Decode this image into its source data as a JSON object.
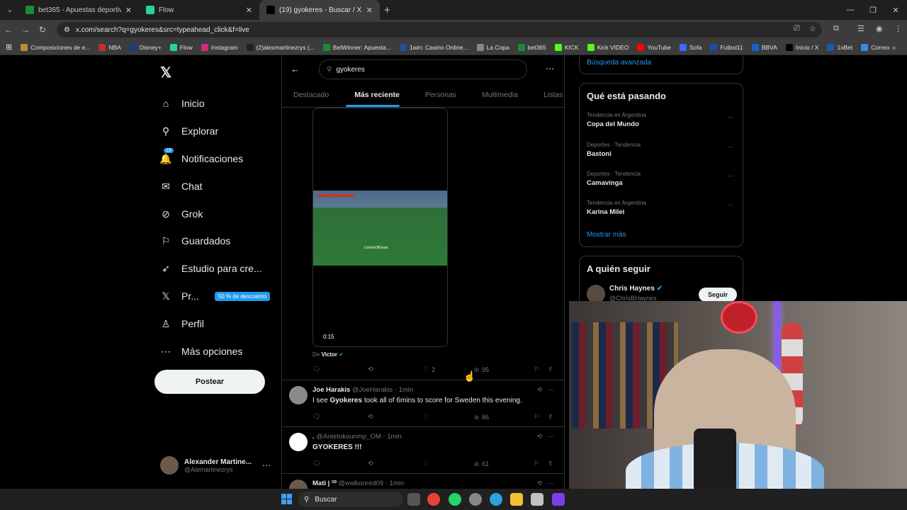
{
  "browser": {
    "tabs": [
      {
        "title": "bet365 - Apuestas deportivas e",
        "color": "#1b8a3c",
        "active": false
      },
      {
        "title": "Flow",
        "color": "#2ad29a",
        "active": false
      },
      {
        "title": "(19) gyokeres - Buscar / X",
        "color": "#000000",
        "active": true
      }
    ],
    "url": "x.com/search?q=gyokeres&src=typeahead_click&f=live",
    "bookmarks": [
      {
        "label": "Composiciones de e...",
        "color": "#c08a3a"
      },
      {
        "label": "NBA",
        "color": "#c0302a"
      },
      {
        "label": "Disney+",
        "color": "#1a3a8a"
      },
      {
        "label": "Flow",
        "color": "#2ad29a"
      },
      {
        "label": "Instagram",
        "color": "#d02a7a"
      },
      {
        "label": "(2)alexmartinezrys (...",
        "color": "#222222"
      },
      {
        "label": "BetWinner: Apuesta...",
        "color": "#1a8a3a"
      },
      {
        "label": "1win: Casino Online...",
        "color": "#2a4a9a"
      },
      {
        "label": "La Copa",
        "color": "#888888"
      },
      {
        "label": "bet365",
        "color": "#1b8a3c"
      },
      {
        "label": "KICK",
        "color": "#53fc18"
      },
      {
        "label": "Kick VIDEO",
        "color": "#53fc18"
      },
      {
        "label": "YouTube",
        "color": "#ff0000"
      },
      {
        "label": "Sofa",
        "color": "#3a6aff"
      },
      {
        "label": "Futbol11",
        "color": "#1a4aaa"
      },
      {
        "label": "BBVA",
        "color": "#1464c8"
      },
      {
        "label": "Inicio / X",
        "color": "#000000"
      },
      {
        "label": "1xBet",
        "color": "#1a5aaa"
      },
      {
        "label": "Correo",
        "color": "#3a8ae8"
      }
    ]
  },
  "sidebar": {
    "items": [
      {
        "label": "Inicio",
        "icon": "⌂"
      },
      {
        "label": "Explorar",
        "icon": "⚲"
      },
      {
        "label": "Notificaciones",
        "icon": "🔔",
        "badge": "19"
      },
      {
        "label": "Chat",
        "icon": "✉"
      },
      {
        "label": "Grok",
        "icon": "⊘"
      },
      {
        "label": "Guardados",
        "icon": "⚐"
      },
      {
        "label": "Estudio para cre...",
        "icon": "➶"
      },
      {
        "label": "Pr...",
        "icon": "𝕏",
        "promo": "50 % de descuento"
      },
      {
        "label": "Perfil",
        "icon": "♙"
      },
      {
        "label": "Más opciones",
        "icon": "⋯"
      }
    ],
    "post_label": "Postear",
    "account": {
      "name": "Alexander Martine...",
      "handle": "@Alemartinezrys"
    }
  },
  "search": {
    "query": "gyokeres",
    "tabs": [
      "Destacado",
      "Más reciente",
      "Personas",
      "Multimedia",
      "Listas"
    ],
    "active_tab": "Más reciente"
  },
  "video_post": {
    "duration": "0:15",
    "watermark": "CenterOfGoals",
    "from_prefix": "De",
    "from_name": "Victor",
    "likes": "2",
    "views": "95"
  },
  "tweets": [
    {
      "name": "Joe Harakis",
      "handle": "@JoeHarakis",
      "time": "1min",
      "text_pre": "I see ",
      "text_bold": "Gyokeres",
      "text_post": " took all of 6mins to score for Sweden this evening.",
      "views": "86",
      "avatar": "#8a8a8a"
    },
    {
      "name": ".",
      "handle": "@Antetokounmp_OM",
      "time": "1min",
      "text_pre": "",
      "text_bold": "GYOKERES !!!",
      "text_post": "",
      "views": "61",
      "avatar": "#ffffff"
    },
    {
      "name": "Mati | ²⁰",
      "handle": "@walkonred09",
      "time": "1min",
      "text_pre": "",
      "text_bold": "",
      "text_post": "",
      "views": "",
      "avatar": "#6a5a4a"
    }
  ],
  "right": {
    "advanced_search": "Búsqueda avanzada",
    "trending_title": "Qué está pasando",
    "trends": [
      {
        "context": "Tendencia en Argentina",
        "name": "Copa del Mundo"
      },
      {
        "context": "Deportes · Tendencia",
        "name": "Bastoni"
      },
      {
        "context": "Deportes · Tendencia",
        "name": "Camavinga"
      },
      {
        "context": "Tendencia en Argentina",
        "name": "Karina Milei"
      }
    ],
    "show_more": "Mostrar más",
    "follow_title": "A quién seguir",
    "suggestion": {
      "name": "Chris Haynes",
      "handle": "@ChrisBHaynes",
      "button": "Seguir"
    }
  },
  "taskbar": {
    "search_placeholder": "Buscar"
  }
}
